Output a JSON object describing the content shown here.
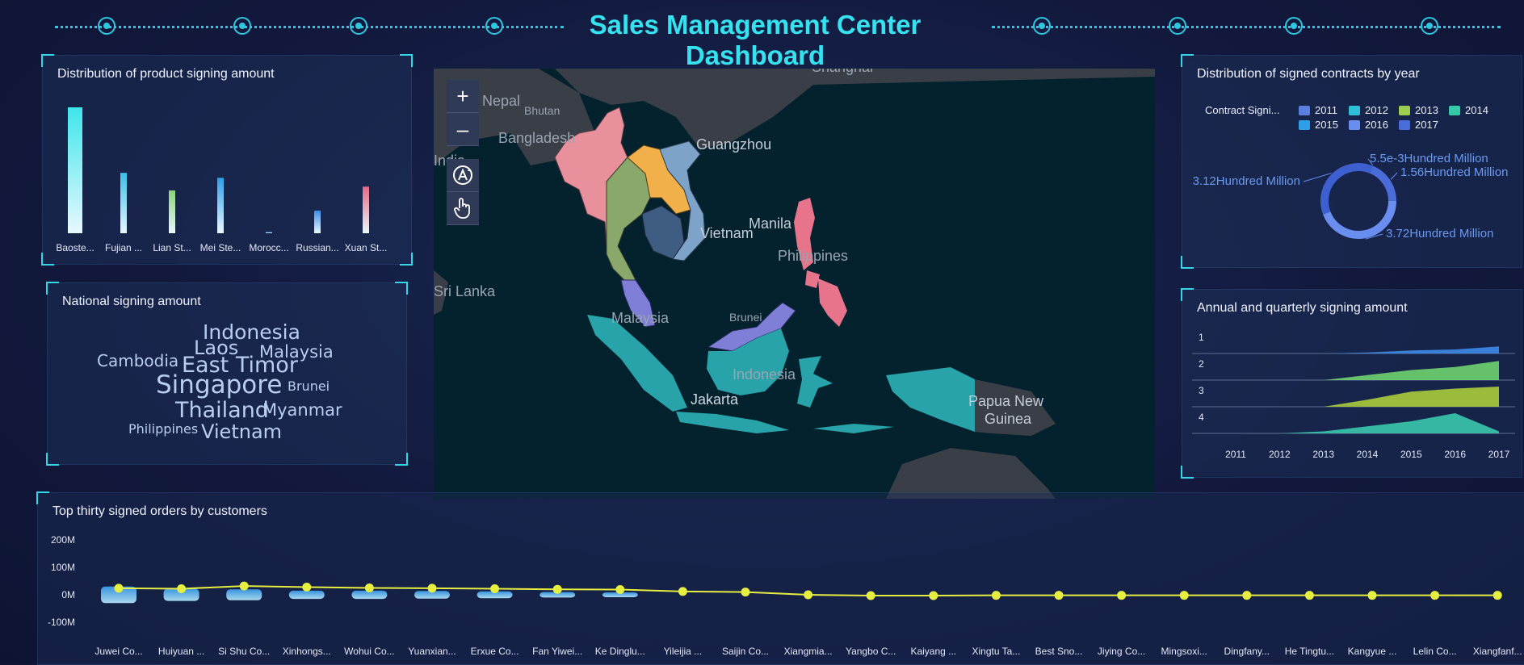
{
  "header": {
    "title": "Sales Management Center Dashboard"
  },
  "product_panel": {
    "title": "Distribution of product signing amount",
    "chart_data": {
      "type": "bar",
      "categories": [
        "Baoste...",
        "Fujian ...",
        "Lian St...",
        "Mei Ste...",
        "Morocc...",
        "Russian...",
        "Xuan St..."
      ],
      "values": [
        100,
        48,
        34,
        44,
        1,
        18,
        37
      ],
      "colors": [
        "#3ee6ea",
        "#3bc0e8",
        "#8bd37a",
        "#2e9fe8",
        "#2e7fd8",
        "#3d8be8",
        "#e66a84"
      ]
    }
  },
  "nation_panel": {
    "title": "National signing amount",
    "words": [
      {
        "text": "Indonesia"
      },
      {
        "text": "Laos"
      },
      {
        "text": "Malaysia"
      },
      {
        "text": "Cambodia"
      },
      {
        "text": "East Timor"
      },
      {
        "text": "Singapore"
      },
      {
        "text": "Brunei"
      },
      {
        "text": "Thailand"
      },
      {
        "text": "Myanmar"
      },
      {
        "text": "Philippines"
      },
      {
        "text": "Vietnam"
      }
    ]
  },
  "map": {
    "zoom_in": "+",
    "zoom_out": "–",
    "labels": {
      "shanghai": "Shanghai",
      "nepal": "Nepal",
      "bhutan": "Bhutan",
      "bangladesh": "Bangladesh",
      "guangzhou": "Guangzhou",
      "india": "India",
      "vietnam": "Vietnam",
      "manila": "Manila",
      "philippines": "Philippines",
      "sri_lanka": "Sri Lanka",
      "malaysia": "Malaysia",
      "brunei": "Brunei",
      "indonesia": "Indonesia",
      "jakarta": "Jakarta",
      "papua": "Papua New",
      "guinea": "Guinea"
    },
    "colors": {
      "myanmar": "#e8909c",
      "thailand": "#8aa86b",
      "laos": "#f2b04a",
      "vietnam": "#7ea3c8",
      "cambodia": "#3f5c83",
      "malaysia": "#7f7fd8",
      "indonesia": "#27a3a9",
      "philippines": "#e8748c",
      "land": "#3a3f47",
      "sea": "#04222e"
    }
  },
  "contracts_panel": {
    "title": "Distribution of signed contracts by year",
    "legend_label": "Contract Signi...",
    "chart_data": {
      "type": "pie",
      "categories": [
        "2011",
        "2012",
        "2013",
        "2014",
        "2015",
        "2016",
        "2017"
      ],
      "colors": [
        "#5b7fe0",
        "#2fc0d8",
        "#9ccd4e",
        "#36c9a8",
        "#2e9ee8",
        "#6a8ef0",
        "#4a6cd8"
      ],
      "slices": [
        {
          "label": "5.5e-3Hundred Million",
          "value": 0.0055
        },
        {
          "label": "1.56Hundred Million",
          "value": 1.56
        },
        {
          "label": "3.72Hundred Million",
          "value": 3.72
        },
        {
          "label": "3.12Hundred Million",
          "value": 3.12
        }
      ]
    }
  },
  "annual_panel": {
    "title": "Annual and quarterly signing amount",
    "chart_data": {
      "type": "area",
      "x": [
        "2011",
        "2012",
        "2013",
        "2014",
        "2015",
        "2016",
        "2017"
      ],
      "rows": [
        {
          "label": "1",
          "color": "#3d8be8",
          "values": [
            0,
            0,
            0,
            0.05,
            0.15,
            0.2,
            0.35
          ]
        },
        {
          "label": "2",
          "color": "#6fd36f",
          "values": [
            0,
            0,
            0,
            0.25,
            0.5,
            0.65,
            0.95
          ]
        },
        {
          "label": "3",
          "color": "#a8cc3a",
          "values": [
            0,
            0,
            0,
            0.35,
            0.75,
            0.9,
            1.0
          ]
        },
        {
          "label": "4",
          "color": "#39c8ae",
          "values": [
            0,
            0,
            0.1,
            0.35,
            0.6,
            1.0,
            0.1
          ]
        }
      ]
    }
  },
  "orders_panel": {
    "title": "Top thirty signed orders by customers",
    "chart_data": {
      "type": "bar",
      "yticks": [
        "200M",
        "100M",
        "0M",
        "-100M"
      ],
      "ylim": [
        -100,
        200
      ],
      "categories": [
        "Juwei Co...",
        "Huiyuan ...",
        "Si Shu Co...",
        "Xinhongs...",
        "Wohui Co...",
        "Yuanxian...",
        "Erxue Co...",
        "Fan Yiwei...",
        "Ke Dinglu...",
        "Yileijia ...",
        "Saijin Co...",
        "Xiangmia...",
        "Yangbo C...",
        "Kaiyang ...",
        "Xingtu Ta...",
        "Best Sno...",
        "Jiying Co...",
        "Mingsoxi...",
        "Dingfany...",
        "He Tingtu...",
        "Kangyue ...",
        "Lelin Co...",
        "Xiangfanf..."
      ],
      "bar_values": [
        60,
        45,
        40,
        30,
        30,
        28,
        25,
        20,
        18,
        0,
        0,
        0,
        0,
        0,
        0,
        0,
        0,
        0,
        0,
        0,
        0,
        0,
        0
      ],
      "line_values": [
        24,
        22,
        32,
        28,
        25,
        24,
        22,
        20,
        19,
        12,
        10,
        0,
        -3,
        -3,
        -2,
        -2,
        -2,
        -2,
        -2,
        -2,
        -2,
        -2,
        -2
      ]
    }
  }
}
